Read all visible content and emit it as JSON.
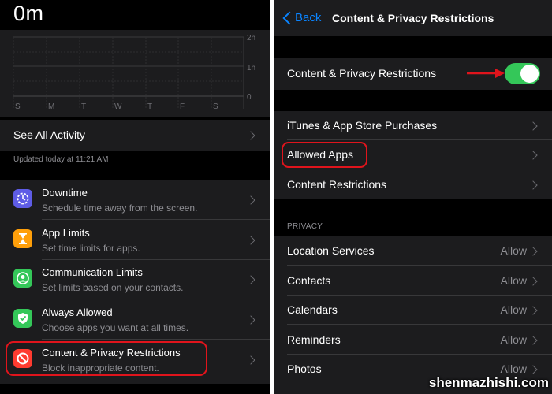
{
  "left": {
    "screen_time": "0m",
    "chart": {
      "days": [
        "S",
        "M",
        "T",
        "W",
        "T",
        "F",
        "S"
      ],
      "y_ticks": [
        "2h",
        "1h",
        "0"
      ]
    },
    "see_all_label": "See All Activity",
    "updated_text": "Updated today at 11:21 AM",
    "items": [
      {
        "title": "Downtime",
        "subtitle": "Schedule time away from the screen.",
        "icon": "downtime-icon",
        "color": "#5e5ce6"
      },
      {
        "title": "App Limits",
        "subtitle": "Set time limits for apps.",
        "icon": "hourglass-icon",
        "color": "#ff9f0a"
      },
      {
        "title": "Communication Limits",
        "subtitle": "Set limits based on your contacts.",
        "icon": "person-circle-icon",
        "color": "#34c759"
      },
      {
        "title": "Always Allowed",
        "subtitle": "Choose apps you want at all times.",
        "icon": "checkmark-shield-icon",
        "color": "#34c759"
      },
      {
        "title": "Content & Privacy Restrictions",
        "subtitle": "Block inappropriate content.",
        "icon": "no-sign-icon",
        "color": "#ff3b30"
      }
    ]
  },
  "right": {
    "back_label": "Back",
    "nav_title": "Content & Privacy Restrictions",
    "toggle_label": "Content & Privacy Restrictions",
    "toggle_on": true,
    "group2": [
      "iTunes & App Store Purchases",
      "Allowed Apps",
      "Content Restrictions"
    ],
    "privacy_header": "PRIVACY",
    "privacy_items": [
      {
        "label": "Location Services",
        "value": "Allow"
      },
      {
        "label": "Contacts",
        "value": "Allow"
      },
      {
        "label": "Calendars",
        "value": "Allow"
      },
      {
        "label": "Reminders",
        "value": "Allow"
      },
      {
        "label": "Photos",
        "value": "Allow"
      }
    ]
  },
  "watermark": "shenmazhishi.com",
  "colors": {
    "accent_blue": "#0a84ff",
    "toggle_green": "#34c759",
    "highlight_red": "#e0141c"
  }
}
